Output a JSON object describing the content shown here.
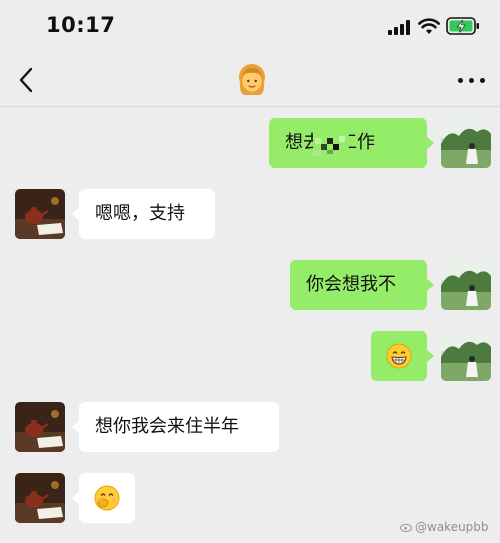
{
  "status_bar": {
    "time": "10:17",
    "icons": [
      "cellular-signal-icon",
      "wifi-icon",
      "battery-charging-icon"
    ],
    "battery_color": "#34c759"
  },
  "nav": {
    "back_icon": "chevron-left-icon",
    "title_emoji": "👩",
    "more_icon": "ellipsis-icon"
  },
  "colors": {
    "background": "#ededed",
    "my_bubble": "#95ec69",
    "their_bubble": "#ffffff"
  },
  "messages": [
    {
      "from": "me",
      "text": "想去国工作",
      "note": "partially censored"
    },
    {
      "from": "them",
      "text": "嗯嗯，支持"
    },
    {
      "from": "me",
      "text": "你会想我不"
    },
    {
      "from": "me",
      "text": "😁"
    },
    {
      "from": "them",
      "text": "想你我会来住半年"
    },
    {
      "from": "them",
      "text": "🤭"
    }
  ],
  "watermark": "@wakeupbb"
}
